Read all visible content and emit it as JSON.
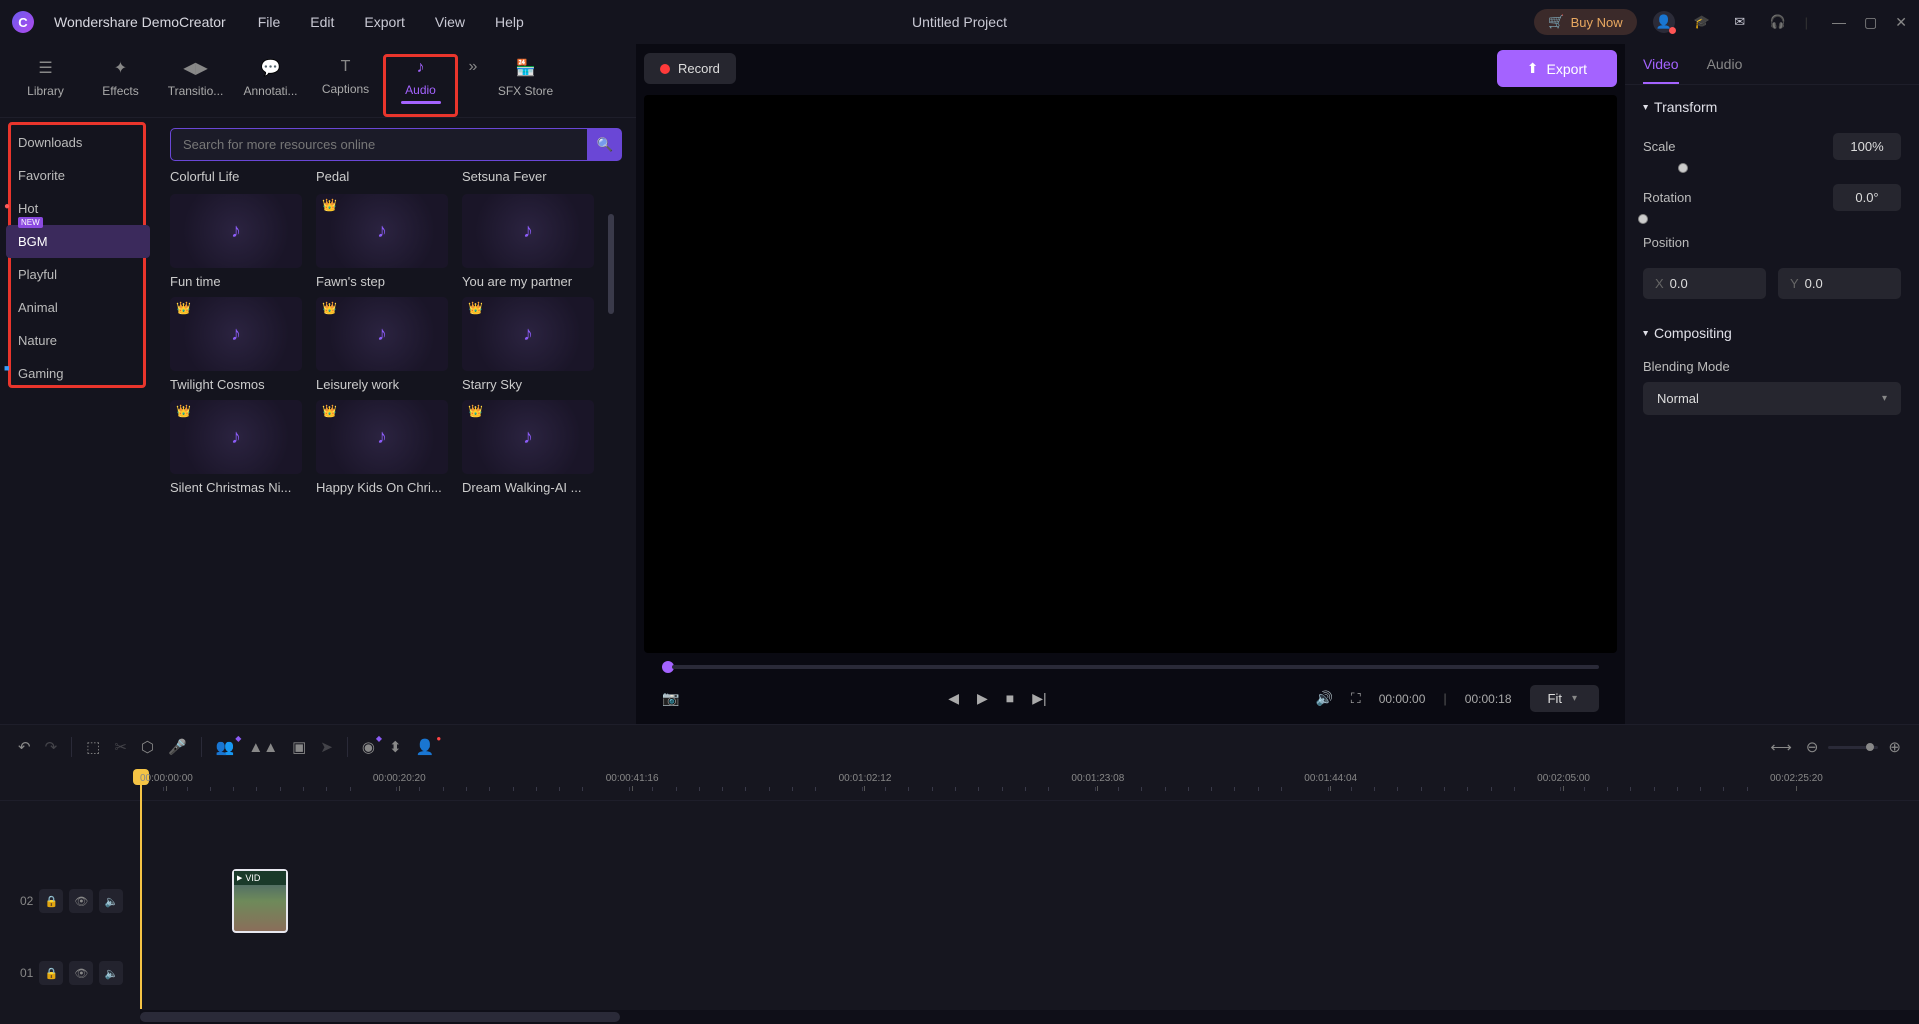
{
  "app": {
    "name": "Wondershare DemoCreator",
    "project": "Untitled Project"
  },
  "menu": [
    "File",
    "Edit",
    "Export",
    "View",
    "Help"
  ],
  "titlebar": {
    "buy_now": "Buy Now"
  },
  "toolbar_right": {
    "export": "Export"
  },
  "record": {
    "label": "Record"
  },
  "media_tabs": [
    {
      "label": "Library"
    },
    {
      "label": "Effects"
    },
    {
      "label": "Transitio..."
    },
    {
      "label": "Annotati..."
    },
    {
      "label": "Captions"
    },
    {
      "label": "Audio"
    },
    {
      "label": "SFX Store"
    }
  ],
  "categories": [
    {
      "label": "Downloads"
    },
    {
      "label": "Favorite"
    },
    {
      "label": "Hot"
    },
    {
      "label": "BGM"
    },
    {
      "label": "Playful"
    },
    {
      "label": "Animal"
    },
    {
      "label": "Nature"
    },
    {
      "label": "Gaming"
    }
  ],
  "search": {
    "placeholder": "Search for more resources online"
  },
  "top_titles": [
    "Colorful Life",
    "Pedal",
    "Setsuna Fever"
  ],
  "thumbs": [
    {
      "label": "Fun time",
      "premium": false
    },
    {
      "label": "Fawn's step",
      "premium": true
    },
    {
      "label": "You are my partner",
      "premium": false
    },
    {
      "label": "Twilight Cosmos",
      "premium": true
    },
    {
      "label": "Leisurely work",
      "premium": true
    },
    {
      "label": "Starry Sky",
      "premium": true
    },
    {
      "label": "Silent Christmas Ni...",
      "premium": true
    },
    {
      "label": "Happy Kids On Chri...",
      "premium": true
    },
    {
      "label": "Dream Walking-AI ...",
      "premium": true
    }
  ],
  "preview": {
    "current": "00:00:00",
    "total": "00:00:18",
    "fit": "Fit"
  },
  "props": {
    "tabs": [
      "Video",
      "Audio"
    ],
    "transform": {
      "title": "Transform",
      "scale_label": "Scale",
      "scale": "100%",
      "rotation_label": "Rotation",
      "rotation": "0.0°",
      "position_label": "Position",
      "x": "0.0",
      "y": "0.0"
    },
    "compositing": {
      "title": "Compositing",
      "blend_label": "Blending Mode",
      "blend_value": "Normal"
    }
  },
  "timeline": {
    "ticks": [
      "00:00:00:00",
      "00:00:20:20",
      "00:00:41:16",
      "00:01:02:12",
      "00:01:23:08",
      "00:01:44:04",
      "00:02:05:00",
      "00:02:25:20"
    ],
    "tracks": [
      "02",
      "01"
    ],
    "clip_label": "VID"
  }
}
